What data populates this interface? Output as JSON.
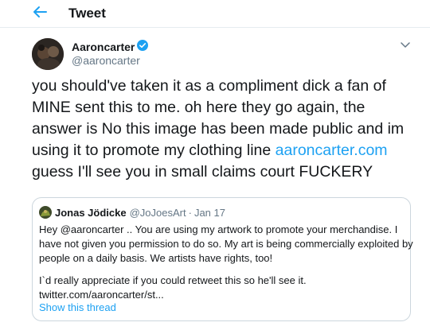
{
  "header": {
    "title": "Tweet"
  },
  "tweet": {
    "author_name": "Aaroncarter",
    "author_handle": "@aaroncarter",
    "text_lines": [
      "you should've taken it as a compliment dick a fan of",
      "MINE sent this to me. oh here they go again, the",
      "answer is No this image has been made public and im",
      "using it to promote my clothing line "
    ],
    "link_text": "aaroncarter.com",
    "last_line": " guess I'll see you in small claims court FUCKERY"
  },
  "quote": {
    "author_name": "Jonas Jödicke",
    "author_handle": "@JoJoesArt",
    "separator": "·",
    "date": "Jan 17",
    "body_lines": [
      "Hey @aaroncarter .. You are using my artwork to promote your merchandise. I",
      "have not given you permission to do so. My art is being commercially exploited by",
      "people on a daily basis. We artists have rights, too!"
    ],
    "body_lines_2": [
      "I`d really appreciate if you could retweet this so he'll see it.",
      "twitter.com/aaroncarter/st..."
    ],
    "show_thread": "Show this thread"
  },
  "icons": {
    "back": "arrow-left-icon",
    "verified": "verified-badge-icon",
    "more": "chevron-down-icon"
  },
  "colors": {
    "accent": "#1da1f2",
    "text": "#14171a",
    "secondary": "#657786",
    "border": "#ccd6dd"
  }
}
